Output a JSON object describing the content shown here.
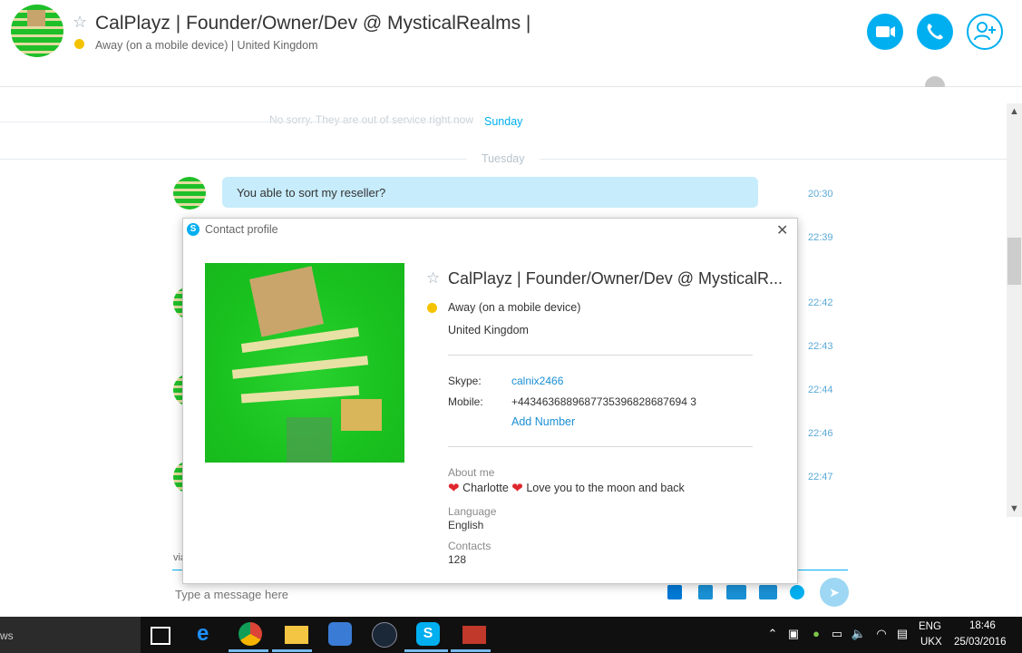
{
  "header": {
    "name": "CalPlayz | Founder/Owner/Dev @ MysticalRealms |",
    "status": "Away (on a mobile device)  |  United Kingdom"
  },
  "chat": {
    "faded_text": "No sorry. They are out of service right now",
    "day_sunday": "Sunday",
    "day_tuesday": "Tuesday",
    "message_1": "You able to sort my reseller?",
    "timestamps": [
      "20:30",
      "22:39",
      "22:42",
      "22:43",
      "22:44",
      "22:46",
      "22:47"
    ],
    "via_text": "via",
    "compose_placeholder": "Type a message here"
  },
  "modal": {
    "title": "Contact profile",
    "name": "CalPlayz | Founder/Owner/Dev @ MysticalR...",
    "status": "Away (on a mobile device)",
    "location": "United Kingdom",
    "skype_label": "Skype:",
    "skype_value": "calnix2466",
    "mobile_label": "Mobile:",
    "mobile_value": "+4434636889687735396828687694 3",
    "add_number": "Add Number",
    "about_label": "About me",
    "about_name": "Charlotte",
    "about_text": "Love you to the moon and back",
    "language_label": "Language",
    "language_value": "English",
    "contacts_label": "Contacts",
    "contacts_value": "128"
  },
  "taskbar": {
    "left_text": "ws",
    "lang_1": "ENG",
    "lang_2": "UKX",
    "time": "18:46",
    "date": "25/03/2016"
  },
  "colors": {
    "skype_blue": "#00aff0",
    "bubble": "#c7ecfc",
    "away_yellow": "#f4c300"
  }
}
